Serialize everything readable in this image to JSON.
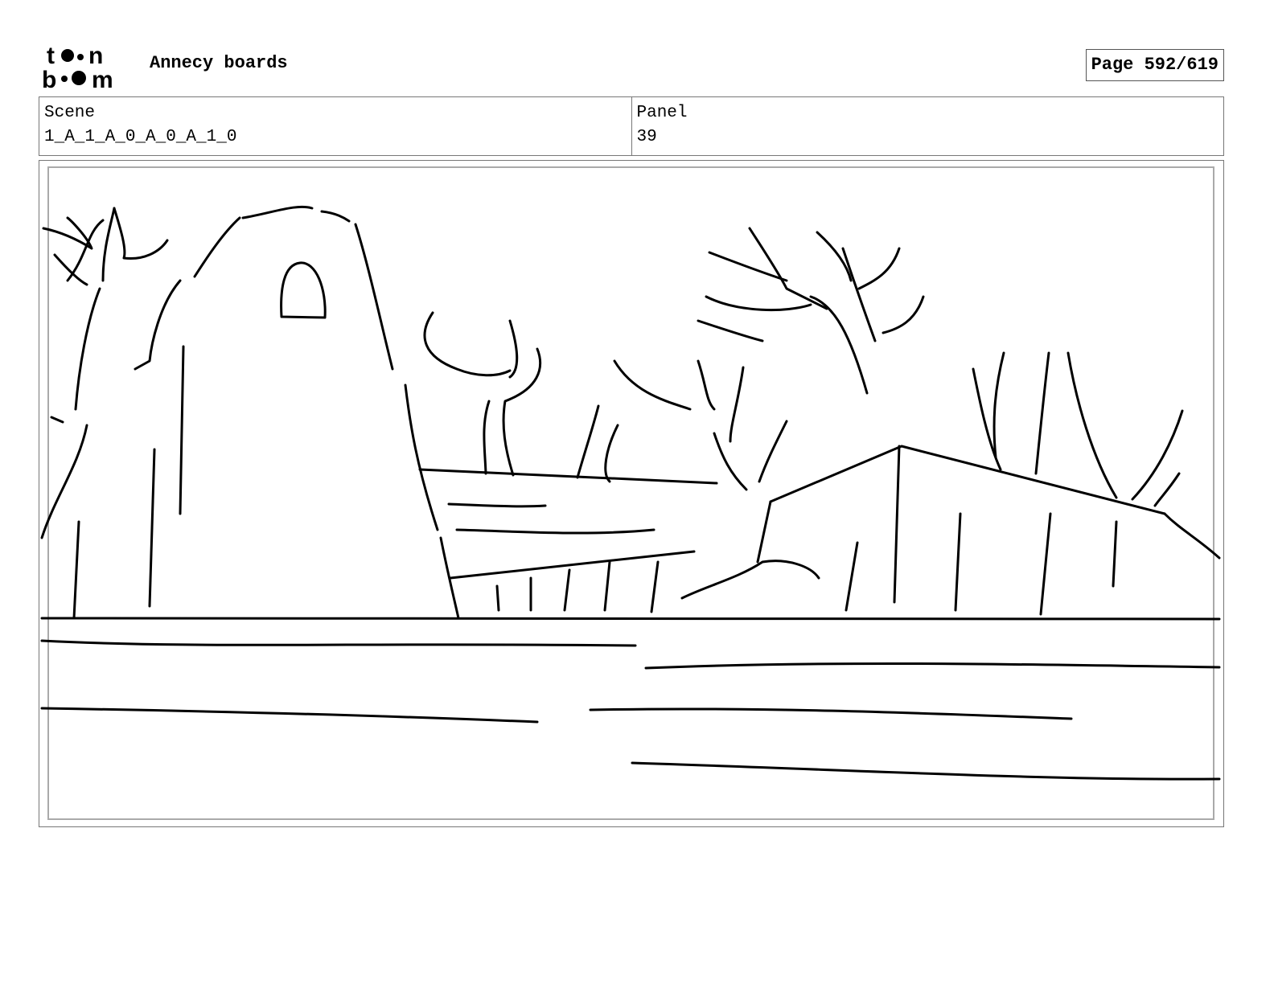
{
  "header": {
    "logo_text": "toon boom",
    "title": "Annecy boards",
    "page_label": "Page 592/619"
  },
  "info": {
    "scene_label": "Scene",
    "scene_value": "1_A_1_A_0_A_0_A_1_0",
    "panel_label": "Panel",
    "panel_value": "39"
  },
  "panel_image": {
    "icon": "storyboard-sketch"
  }
}
